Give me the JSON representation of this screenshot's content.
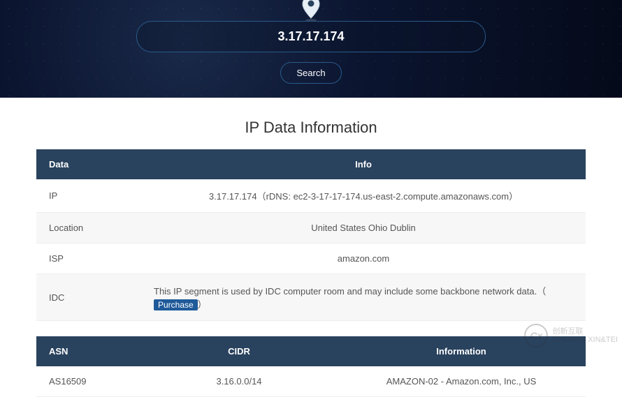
{
  "hero": {
    "ip_value": "3.17.17.174",
    "search_label": "Search"
  },
  "section_title": "IP Data Information",
  "table1": {
    "headers": {
      "data": "Data",
      "info": "Info"
    },
    "rows": [
      {
        "label": "IP",
        "value": "3.17.17.174（rDNS: ec2-3-17-17-174.us-east-2.compute.amazonaws.com）"
      },
      {
        "label": "Location",
        "value": "United States Ohio Dublin"
      },
      {
        "label": "ISP",
        "value": "amazon.com"
      },
      {
        "label": "IDC",
        "value_prefix": "This IP segment is used by IDC computer room and may include some backbone network data.（",
        "purchase": "Purchase",
        "value_suffix": "）"
      }
    ]
  },
  "table2": {
    "headers": {
      "asn": "ASN",
      "cidr": "CIDR",
      "info": "Information"
    },
    "rows": [
      {
        "asn": "AS16509",
        "cidr": "3.16.0.0/14",
        "info": "AMAZON-02 - Amazon.com, Inc., US"
      }
    ]
  },
  "watermark": {
    "brand_cn": "创新互联",
    "brand_en": "CHUANG XIN&TEI"
  }
}
